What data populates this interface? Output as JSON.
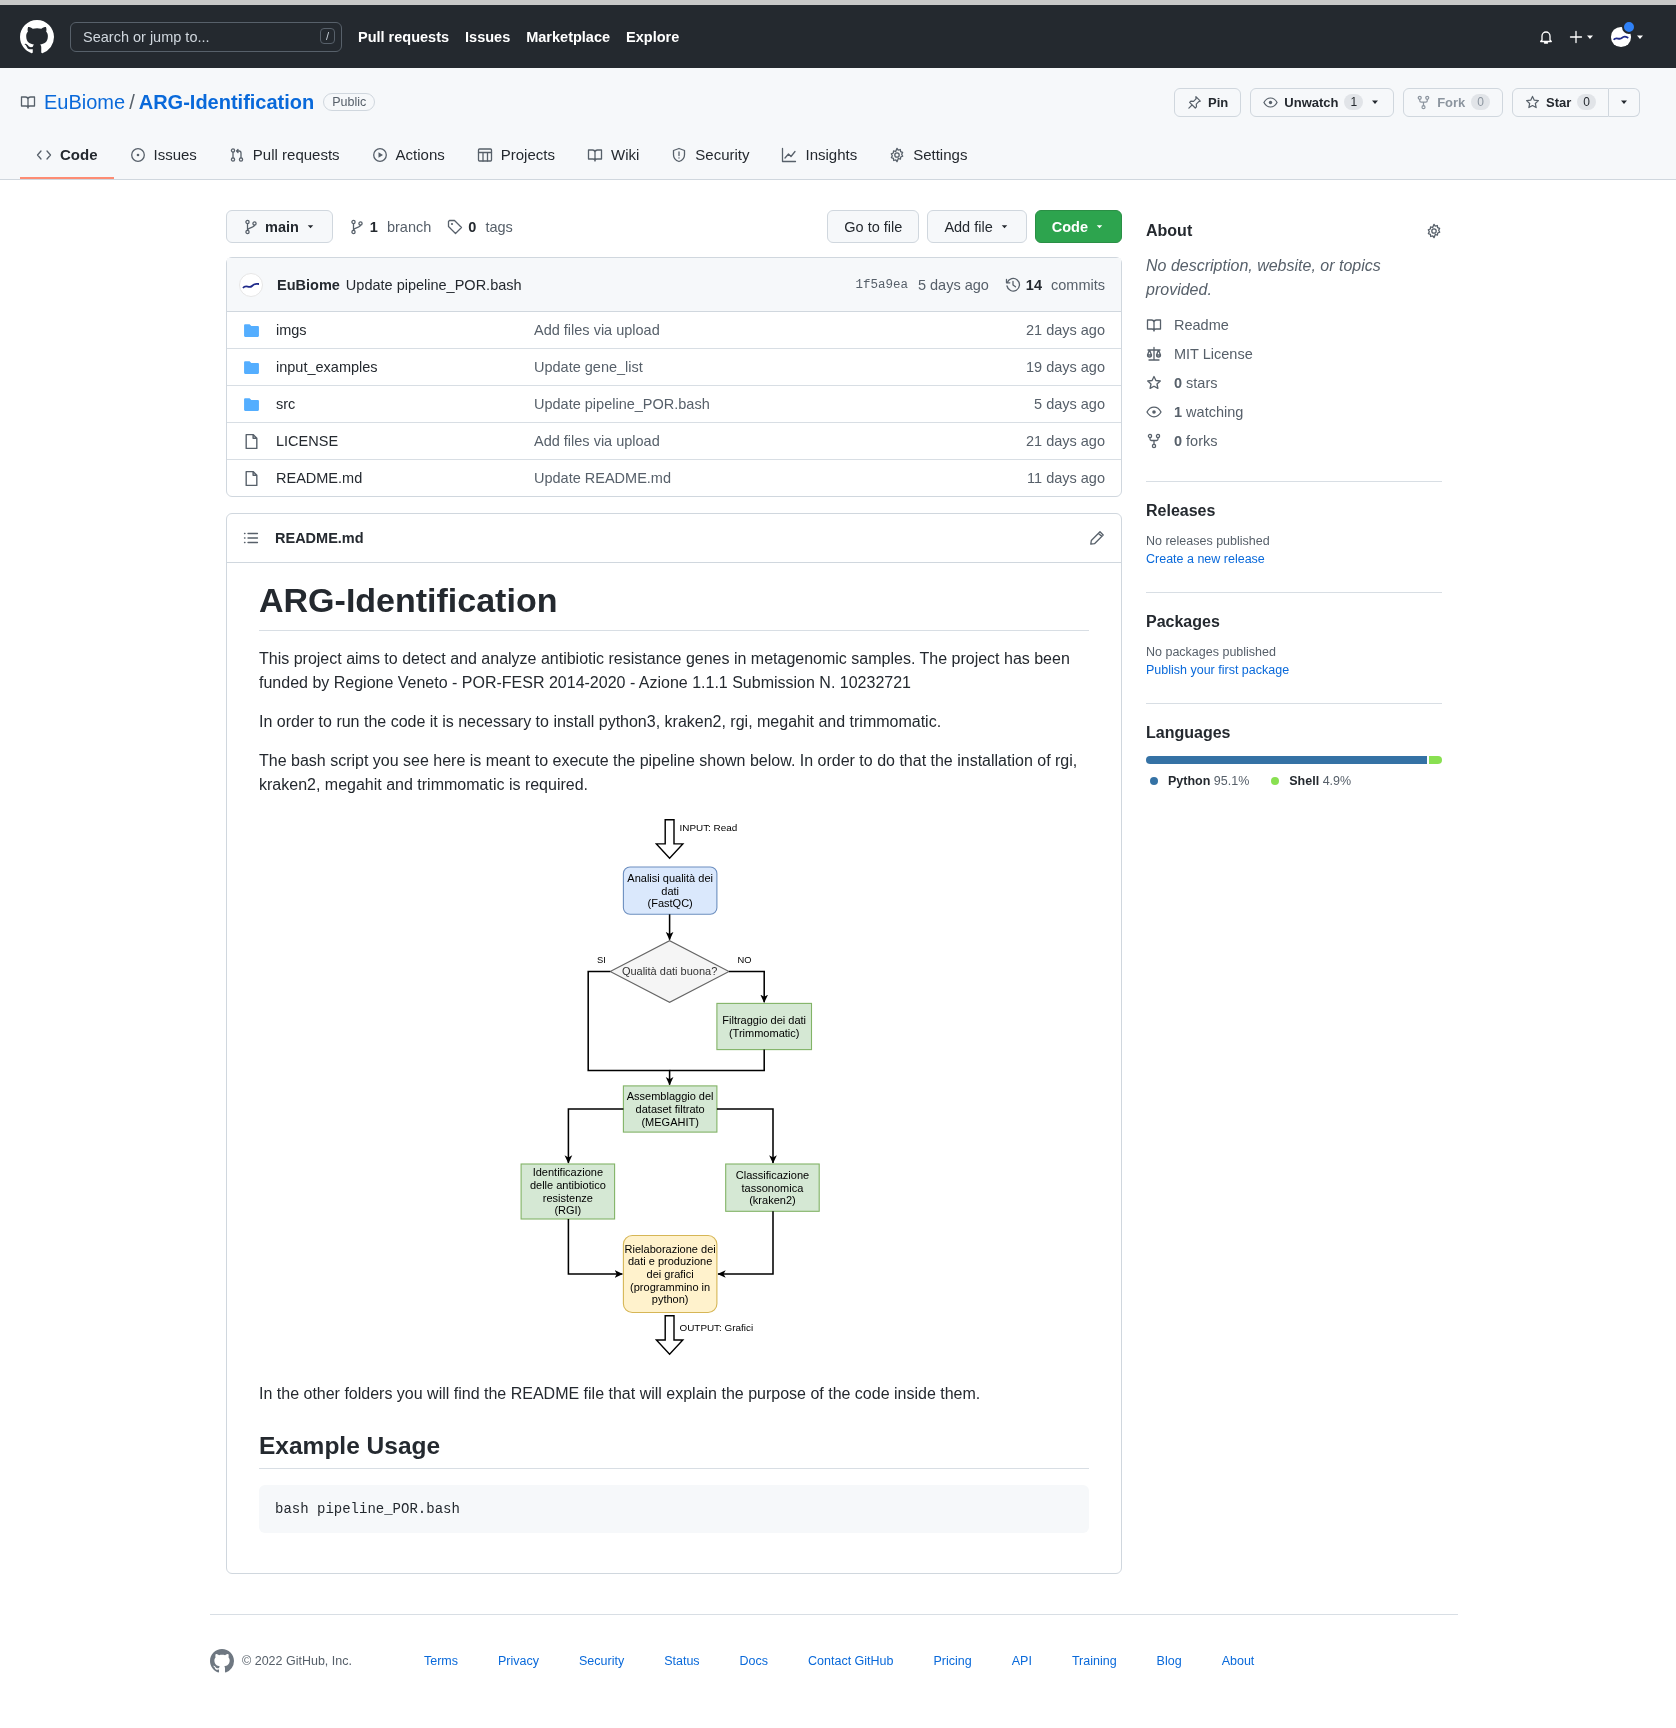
{
  "header": {
    "search_placeholder": "Search or jump to...",
    "search_key": "/",
    "nav": [
      "Pull requests",
      "Issues",
      "Marketplace",
      "Explore"
    ],
    "has_notification": true
  },
  "repo": {
    "owner": "EuBiome",
    "separator": "/",
    "name": "ARG-Identification",
    "visibility": "Public",
    "actions": [
      {
        "label": "Pin",
        "caret": false,
        "split": false,
        "disabled": false
      },
      {
        "label": "Unwatch",
        "count": "1",
        "caret": true,
        "split": false,
        "disabled": false
      },
      {
        "label": "Fork",
        "count": "0",
        "caret": false,
        "split": false,
        "disabled": true
      },
      {
        "label": "Star",
        "count": "0",
        "caret": false,
        "split": true,
        "disabled": false
      }
    ],
    "tabs": [
      {
        "label": "Code",
        "selected": true
      },
      {
        "label": "Issues",
        "selected": false
      },
      {
        "label": "Pull requests",
        "selected": false
      },
      {
        "label": "Actions",
        "selected": false
      },
      {
        "label": "Projects",
        "selected": false
      },
      {
        "label": "Wiki",
        "selected": false
      },
      {
        "label": "Security",
        "selected": false
      },
      {
        "label": "Insights",
        "selected": false
      },
      {
        "label": "Settings",
        "selected": false
      }
    ]
  },
  "branch_bar": {
    "branch": "main",
    "branches_count": "1",
    "branches_label": "branch",
    "tags_count": "0",
    "tags_label": "tags",
    "buttons": [
      {
        "label": "Go to file",
        "kind": "plain"
      },
      {
        "label": "Add file",
        "kind": "menu"
      },
      {
        "label": "Code",
        "kind": "primary"
      }
    ]
  },
  "commit": {
    "author": "EuBiome",
    "message": "Update pipeline_POR.bash",
    "sha": "1f5a9ea",
    "time": "5 days ago",
    "commits_count": "14",
    "commits_label": "commits"
  },
  "files": [
    {
      "kind": "dir",
      "name": "imgs",
      "message": "Add files via upload",
      "time": "21 days ago"
    },
    {
      "kind": "dir",
      "name": "input_examples",
      "message": "Update gene_list",
      "time": "19 days ago"
    },
    {
      "kind": "dir",
      "name": "src",
      "message": "Update pipeline_POR.bash",
      "time": "5 days ago"
    },
    {
      "kind": "file",
      "name": "LICENSE",
      "message": "Add files via upload",
      "time": "21 days ago"
    },
    {
      "kind": "file",
      "name": "README.md",
      "message": "Update README.md",
      "time": "11 days ago"
    }
  ],
  "readme": {
    "filename": "README.md",
    "blocks": [
      {
        "kind": "h1",
        "text": "ARG-Identification"
      },
      {
        "kind": "p",
        "text": "This project aims to detect and analyze antibiotic resistance genes in metagenomic samples. The project has been funded by Regione Veneto - POR-FESR 2014-2020 - Azione 1.1.1 Submission N. 10232721"
      },
      {
        "kind": "p",
        "text": "In order to run the code it is necessary to install python3, kraken2, rgi, megahit and trimmomatic."
      },
      {
        "kind": "p",
        "text": "The bash script you see here is meant to execute the pipeline shown below. In order to do that the installation of rgi, kraken2, megahit and trimmomatic is required."
      },
      {
        "kind": "diagram",
        "input_label": "INPUT: Read",
        "output_label": "OUTPUT: Grafici",
        "yes_label": "SI",
        "no_label": "NO",
        "decision": "Qualità dati buona?",
        "steps": [
          {
            "kind": "start",
            "lines": [
              "Analisi qualità dei",
              "dati",
              "(FastQC)"
            ]
          },
          {
            "kind": "process",
            "lines": [
              "Filtraggio dei dati",
              "(Trimmomatic)"
            ]
          },
          {
            "kind": "process",
            "lines": [
              "Assemblaggio del",
              "dataset filtrato",
              "(MEGAHIT)"
            ]
          },
          {
            "kind": "process",
            "lines": [
              "Identificazione",
              "delle antibiotico",
              "resistenze",
              "(RGI)"
            ]
          },
          {
            "kind": "process",
            "lines": [
              "Classificazione",
              "tassonomica",
              "(kraken2)"
            ]
          },
          {
            "kind": "end",
            "lines": [
              "Rielaborazione dei",
              "dati e produzione",
              "dei grafici",
              "(programmino in",
              "python)"
            ]
          }
        ]
      },
      {
        "kind": "p",
        "text": "In the other folders you will find the README file that will explain the purpose of the code inside them."
      },
      {
        "kind": "h2",
        "text": "Example Usage"
      },
      {
        "kind": "code",
        "text": "bash pipeline_POR.bash"
      }
    ]
  },
  "sidebar": {
    "about_title": "About",
    "description": "No description, website, or topics provided.",
    "meta": [
      {
        "text": "Readme"
      },
      {
        "text": "MIT License"
      },
      {
        "bold": "0",
        "text": "stars"
      },
      {
        "bold": "1",
        "text": "watching"
      },
      {
        "bold": "0",
        "text": "forks"
      }
    ],
    "sections": [
      {
        "title": "Releases",
        "note": "No releases published",
        "link": "Create a new release"
      },
      {
        "title": "Packages",
        "note": "No packages published",
        "link": "Publish your first package"
      }
    ],
    "languages_title": "Languages",
    "languages": [
      {
        "name": "Python",
        "percent": "95.1%",
        "color": "#3572a5"
      },
      {
        "name": "Shell",
        "percent": "4.9%",
        "color": "#89e051"
      }
    ]
  },
  "footer": {
    "copyright": "© 2022 GitHub, Inc.",
    "links": [
      "Terms",
      "Privacy",
      "Security",
      "Status",
      "Docs",
      "Contact GitHub",
      "Pricing",
      "API",
      "Training",
      "Blog",
      "About"
    ]
  }
}
